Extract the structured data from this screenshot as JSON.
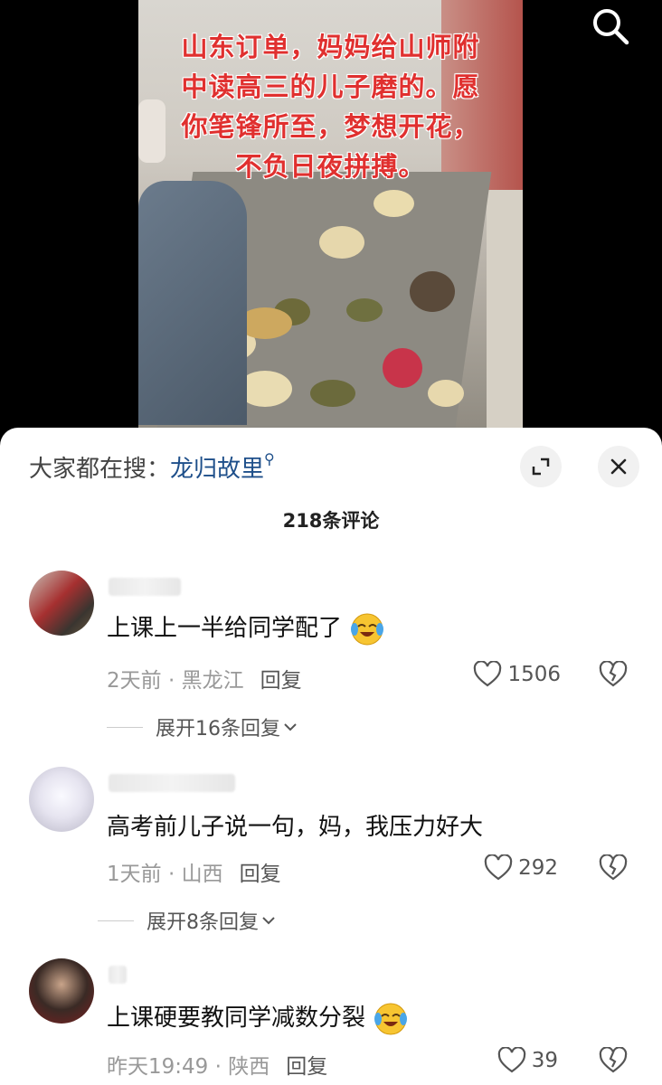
{
  "video": {
    "caption": "山东订单，妈妈给山师附中读高三的儿子磨的。愿你笔锋所至，梦想开花，不负日夜拼搏。"
  },
  "icons": {
    "search": "search-icon",
    "expand": "expand-icon",
    "close": "close-icon",
    "like": "heart-icon",
    "dislike": "broken-heart-icon",
    "chevron": "chevron-down-icon",
    "emoji": "crying-laughing-emoji"
  },
  "sheet": {
    "trending_label": "大家都在搜：",
    "trending_keyword": "龙归故里",
    "comment_count": "218条评论"
  },
  "comments": [
    {
      "text": "上课上一半给同学配了",
      "time": "2天前",
      "location": "黑龙江",
      "reply": "回复",
      "likes": "1506",
      "expand": "展开16条回复"
    },
    {
      "text": "高考前儿子说一句，妈，我压力好大",
      "time": "1天前",
      "location": "山西",
      "reply": "回复",
      "likes": "292",
      "expand": "展开8条回复"
    },
    {
      "text": "上课硬要教同学减数分裂",
      "time": "昨天19:49",
      "location": "陕西",
      "reply": "回复",
      "likes": "39"
    }
  ],
  "colors": {
    "caption": "#e0302f",
    "keyword": "#1e4f8a",
    "meta": "#999999"
  }
}
